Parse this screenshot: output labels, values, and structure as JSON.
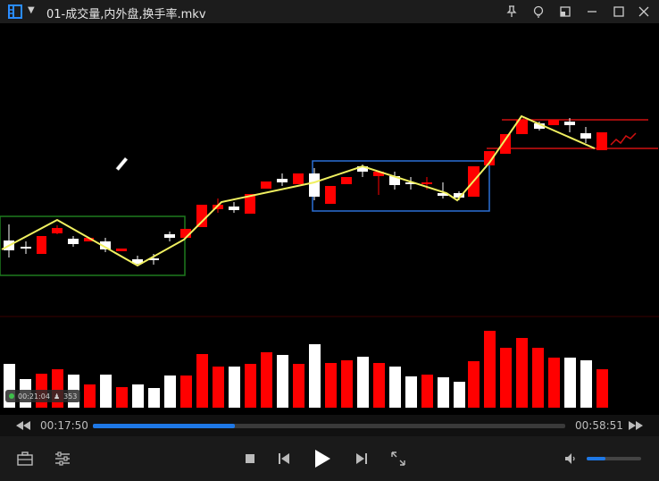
{
  "window": {
    "title": "01-成交量,内外盘,换手率.mkv",
    "icons": [
      "app-logo-icon",
      "menu-caret-icon",
      "pin-icon",
      "skin-icon",
      "mini-mode-icon",
      "minimize-icon",
      "maximize-icon",
      "close-icon"
    ]
  },
  "overlay": {
    "badge_time": "00:21:04",
    "badge_count": "353"
  },
  "playback": {
    "current_time": "00:17:50",
    "total_time": "00:58:51",
    "progress": 0.3,
    "volume": 0.35
  },
  "controls": {
    "icons": [
      "toolbox-icon",
      "settings-icon",
      "stop-icon",
      "previous-icon",
      "play-icon",
      "next-icon",
      "fullscreen-icon",
      "volume-icon",
      "rewind-icon",
      "forward-icon"
    ]
  },
  "colors": {
    "accent": "#1e78e6",
    "up": "#ff0000",
    "down": "#ffffff",
    "trend": "#f0f060"
  }
}
